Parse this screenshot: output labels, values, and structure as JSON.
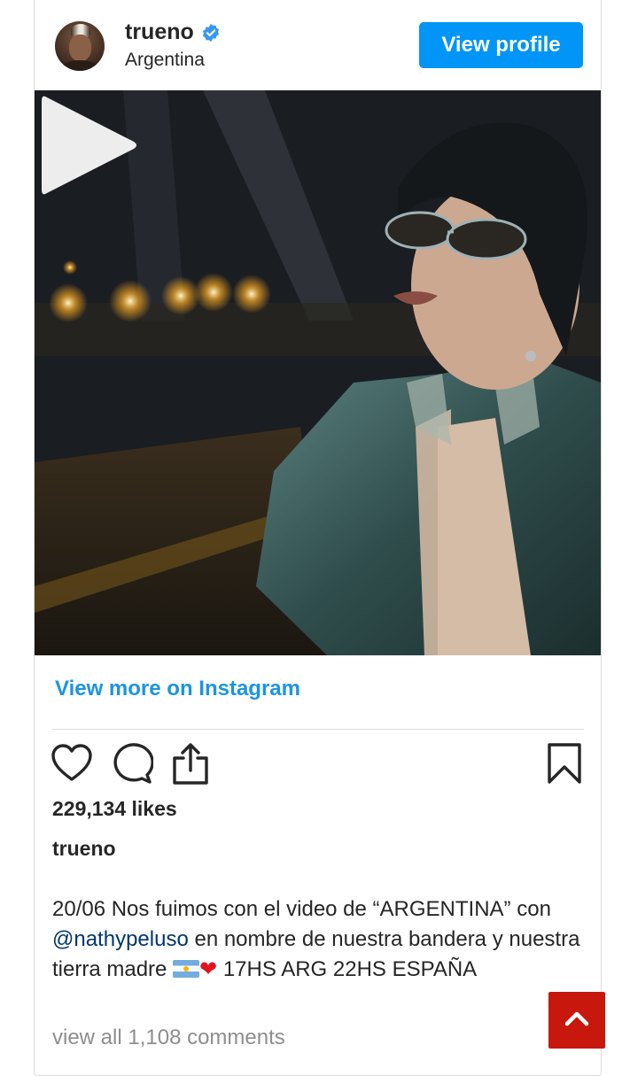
{
  "profile": {
    "username": "trueno",
    "location": "Argentina",
    "view_profile_label": "View profile"
  },
  "media": {
    "play_icon": "play-icon"
  },
  "links": {
    "view_more": "View more on Instagram"
  },
  "actions": {
    "icons": [
      "heart-icon",
      "comment-icon",
      "share-icon",
      "bookmark-icon"
    ]
  },
  "post": {
    "likes": "229,134 likes",
    "caption_username": "trueno",
    "caption_part1": "20/06 Nos fuimos con el video de “ARGENTINA” con ",
    "mention": "@nathypeluso",
    "caption_part2": " en nombre de nuestra bandera y nuestra tierra madre ",
    "caption_emoji_heart": "❤",
    "caption_part3": " 17HS ARG 22HS ESPAÑA",
    "comments_link": "view all 1,108 comments"
  },
  "colors": {
    "button_blue": "#0095f6",
    "link_blue": "#1b95e0",
    "mention_blue": "#00376b",
    "scroll_top_red": "#c8170d"
  }
}
